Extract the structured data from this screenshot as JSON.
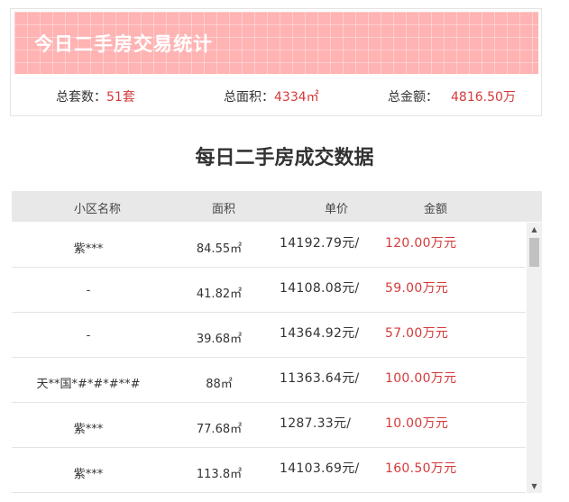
{
  "summary": {
    "title": "今日二手房交易统计",
    "count_label": "总套数：",
    "count_value": "51套",
    "area_label": "总面积：",
    "area_value": "4334㎡",
    "amount_label": "总金额：",
    "amount_value": "4816.50万"
  },
  "section": {
    "title": "每日二手房成交数据"
  },
  "table": {
    "headers": [
      "小区名称",
      "面积",
      "单价",
      "金额"
    ],
    "rows": [
      {
        "name": "紫***",
        "area": "84.55㎡",
        "price": "14192.79元/",
        "amount": "120.00万元"
      },
      {
        "name": "-",
        "area": "41.82㎡",
        "price": "14108.08元/",
        "amount": "59.00万元"
      },
      {
        "name": "-",
        "area": "39.68㎡",
        "price": "14364.92元/",
        "amount": "57.00万元"
      },
      {
        "name": "天**国*#*#*#**#",
        "area": "88㎡",
        "price": "11363.64元/",
        "amount": "100.00万元"
      },
      {
        "name": "紫***",
        "area": "77.68㎡",
        "price": "1287.33元/",
        "amount": "10.00万元"
      },
      {
        "name": "紫***",
        "area": "113.8㎡",
        "price": "14103.69元/",
        "amount": "160.50万元"
      }
    ]
  },
  "scrollbar": {
    "up_icon": "▲",
    "down_icon": "▼"
  }
}
